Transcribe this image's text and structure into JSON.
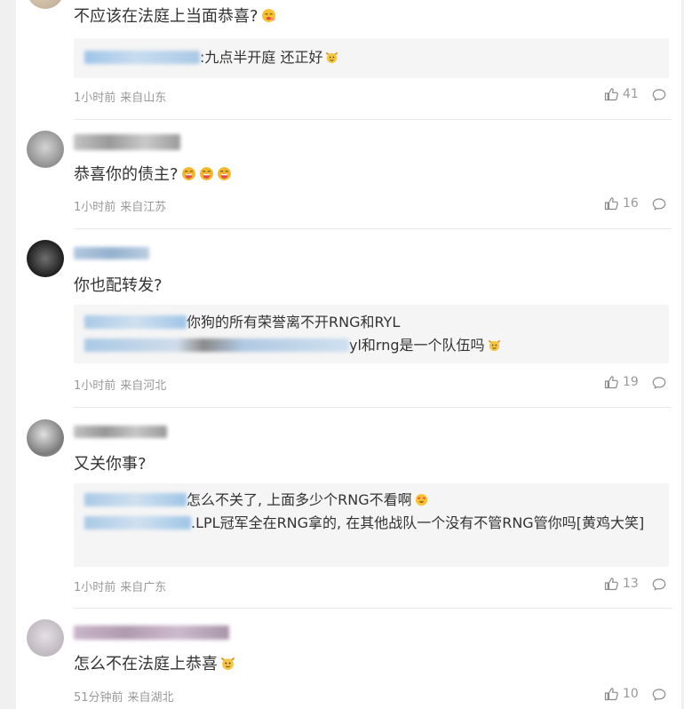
{
  "comments": [
    {
      "text": "不应该在法庭上当面恭喜?",
      "replies": [
        {
          "text": ":九点半开庭 还正好"
        }
      ],
      "time": "1小时前",
      "location": "来自山东",
      "likes": "41"
    },
    {
      "text": "恭喜你的债主?",
      "replies": [],
      "time": "1小时前",
      "location": "来自江苏",
      "likes": "16"
    },
    {
      "text": "你也配转发?",
      "replies": [
        {
          "text": "你狗的所有荣誉离不开RNG和RYL"
        },
        {
          "text": "yl和rng是一个队伍吗"
        }
      ],
      "time": "1小时前",
      "location": "来自河北",
      "likes": "19"
    },
    {
      "text": "又关你事?",
      "replies": [
        {
          "text": "怎么不关了, 上面多少个RNG不看啊"
        },
        {
          "text": ".LPL冠军全在RNG拿的, 在其他战队一个没有不管RNG管你吗[黄鸡大笑]"
        }
      ],
      "time": "1小时前",
      "location": "来自广东",
      "likes": "13"
    },
    {
      "text": "怎么不在法庭上恭喜",
      "replies": [],
      "time": "51分钟前",
      "location": "来自湖北",
      "likes": "10"
    }
  ],
  "icons": {
    "like": "thumbs-up-icon",
    "reply": "comment-bubble-icon"
  },
  "colors": {
    "meta": "#999999",
    "quote_bg": "#f5f5f5",
    "divider": "#e8e8e8",
    "emoji_yellow": "#f5c542",
    "emoji_red": "#e8464a"
  }
}
